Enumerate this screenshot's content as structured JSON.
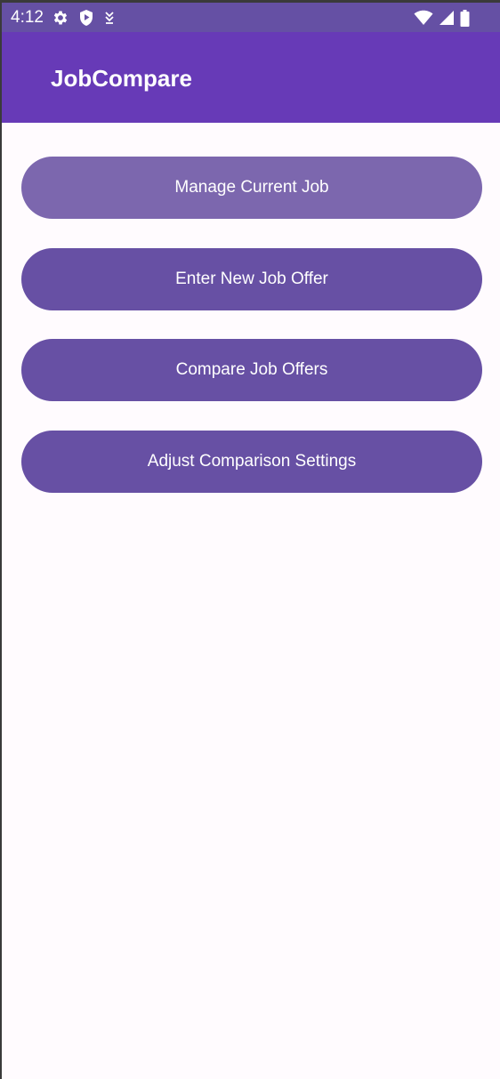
{
  "status_bar": {
    "time": "4:12",
    "left_icons": [
      "gear-icon",
      "shield-play-icon",
      "download-icon"
    ],
    "right_icons": [
      "wifi-icon",
      "cell-signal-icon",
      "battery-icon"
    ]
  },
  "app_bar": {
    "title": "JobCompare",
    "color": "#673ab7"
  },
  "main": {
    "buttons": [
      {
        "label": "Manage Current Job",
        "state": "pressed"
      },
      {
        "label": "Enter New Job Offer",
        "state": "normal"
      },
      {
        "label": "Compare Job Offers",
        "state": "normal"
      },
      {
        "label": "Adjust Comparison Settings",
        "state": "normal"
      }
    ],
    "button_color": "#6750a4",
    "pressed_color": "#7c67ae",
    "background": "#fffbfe"
  }
}
